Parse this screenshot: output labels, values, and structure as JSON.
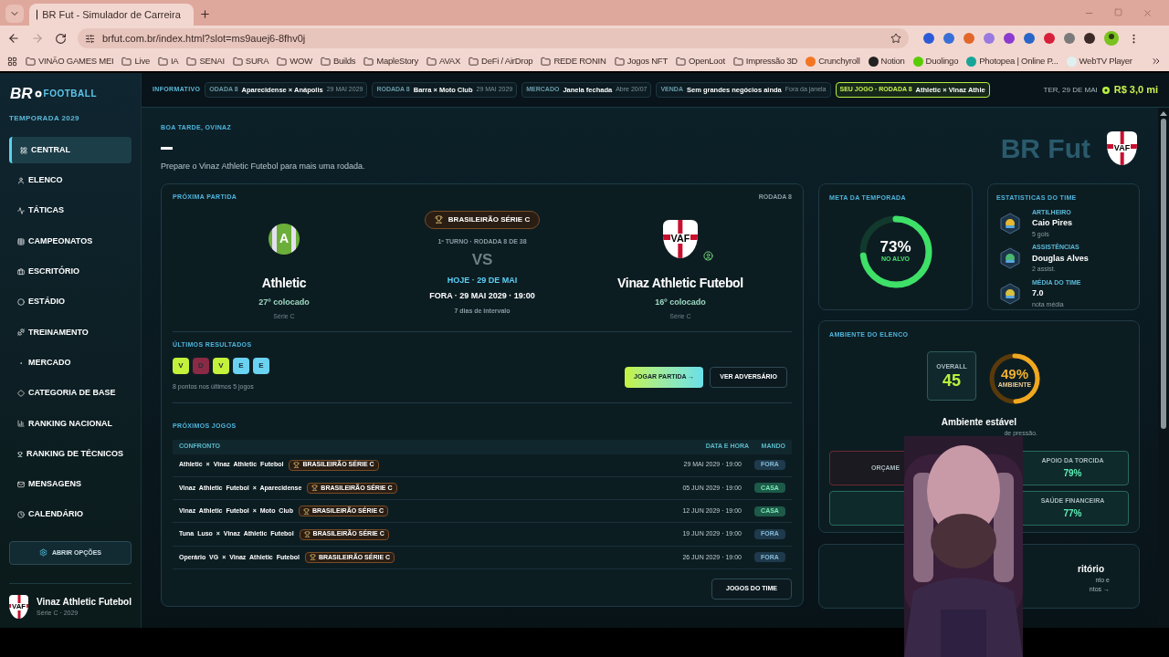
{
  "browser": {
    "tab_title": "BR Fut - Simulador de Carreira",
    "url": "brfut.com.br/index.html?slot=ms9auej6-8fhv0j",
    "bookmarks": [
      {
        "label": "VINÃO GAMES MEI",
        "kind": "folder"
      },
      {
        "label": "Live",
        "kind": "folder"
      },
      {
        "label": "IA",
        "kind": "folder"
      },
      {
        "label": "SENAI",
        "kind": "folder"
      },
      {
        "label": "SURA",
        "kind": "folder"
      },
      {
        "label": "WOW",
        "kind": "folder"
      },
      {
        "label": "Builds",
        "kind": "folder"
      },
      {
        "label": "MapleStory",
        "kind": "folder"
      },
      {
        "label": "AVAX",
        "kind": "folder"
      },
      {
        "label": "DeFi / AirDrop",
        "kind": "folder"
      },
      {
        "label": "REDE RONIN",
        "kind": "folder"
      },
      {
        "label": "Jogos NFT",
        "kind": "folder"
      },
      {
        "label": "OpenLoot",
        "kind": "folder"
      },
      {
        "label": "Impressão 3D",
        "kind": "folder"
      },
      {
        "label": "Crunchyroll",
        "kind": "site",
        "color": "#f47521"
      },
      {
        "label": "Notion",
        "kind": "site",
        "color": "#222222"
      },
      {
        "label": "Duolingo",
        "kind": "site",
        "color": "#58cc02"
      },
      {
        "label": "Photopea | Online P...",
        "kind": "site",
        "color": "#18a497"
      },
      {
        "label": "WebTV Player",
        "kind": "site",
        "color": "#e0f0f0"
      }
    ]
  },
  "sidebar": {
    "logo": {
      "mark": "BR",
      "word": "FOOTBALL"
    },
    "season": "TEMPORADA 2029",
    "items": [
      {
        "label": "CENTRAL",
        "selected": true
      },
      {
        "label": "ELENCO",
        "selected": false
      },
      {
        "label": "TÁTICAS",
        "selected": false
      },
      {
        "label": "CAMPEONATOS",
        "selected": false
      },
      {
        "label": "ESCRITÓRIO",
        "selected": false
      },
      {
        "label": "ESTÁDIO",
        "selected": false
      },
      {
        "label": "TREINAMENTO",
        "selected": false
      },
      {
        "label": "MERCADO",
        "selected": false
      },
      {
        "label": "CATEGORIA DE BASE",
        "selected": false
      },
      {
        "label": "RANKING NACIONAL",
        "selected": false
      },
      {
        "label": "RANKING DE TÉCNICOS",
        "selected": false
      },
      {
        "label": "MENSAGENS",
        "selected": false
      },
      {
        "label": "CALENDÁRIO",
        "selected": false
      }
    ],
    "options_button": "ABRIR OPÇÕES",
    "club": {
      "crest": "VAF",
      "name": "Vinaz Athletic Futebol",
      "sub": "Série C · 2029"
    }
  },
  "ticker": {
    "label": "INFORMATIVO",
    "items": [
      {
        "tag": "ODADA 8",
        "text": "Aparecidense × Anápolis",
        "note": "29 MAI 2029",
        "highlight": false
      },
      {
        "tag": "RODADA 8",
        "text": "Barra × Moto Club",
        "note": "29 MAI 2029",
        "highlight": false
      },
      {
        "tag": "MERCADO",
        "text": "Janela fechada",
        "note": "Abre 20/07",
        "highlight": false
      },
      {
        "tag": "VENDA",
        "text": "Sem grandes negócios ainda",
        "note": "Fora da janela",
        "highlight": false
      },
      {
        "tag": "SEU JOGO · RODADA 8",
        "text": "Athletic × Vinaz Athle",
        "highlight": true
      }
    ],
    "date": "TER, 29 DE MAI",
    "money": "R$ 3,0 mi"
  },
  "header": {
    "greeting": "BOA TARDE, OVINAZ",
    "subtitle": "Prepare o Vinaz Athletic Futebol para mais uma rodada.",
    "watermark": "BR Fut",
    "crest": "VAF"
  },
  "next_match": {
    "title": "PRÓXIMA PARTIDA",
    "round": "RODADA 8",
    "home": {
      "crest": "A",
      "name": "Athletic",
      "place": "27º colocado",
      "division": "Série C"
    },
    "away": {
      "crest": "VAF",
      "name": "Vinaz Athletic Futebol",
      "place": "16º colocado",
      "division": "Série C"
    },
    "competition": "BRASILEIRÃO SÉRIE C",
    "stage": "1º TURNO · RODADA 8 DE 38",
    "vs": "VS",
    "when": "HOJE · 29 DE MAI",
    "detail": "FORA · 29 MAI 2029 · 19:00",
    "rest": "7 dias de intervalo",
    "results_title": "ÚLTIMOS RESULTADOS",
    "results": [
      {
        "letter": "V",
        "color": "#c4f23a"
      },
      {
        "letter": "D",
        "color": "#8a2a45"
      },
      {
        "letter": "V",
        "color": "#c4f23a"
      },
      {
        "letter": "E",
        "color": "#6ad3f2"
      },
      {
        "letter": "E",
        "color": "#6ad3f2"
      }
    ],
    "results_note": "8 pontos nos últimos 5 jogos",
    "play_button": "JOGAR PARTIDA →",
    "opponent_button": "VER ADVERSÁRIO",
    "upcoming_title": "PRÓXIMOS JOGOS",
    "columns": [
      "CONFRONTO",
      "DATA E HORA",
      "MANDO"
    ],
    "rows": [
      {
        "matchup": "Athletic × Vinaz Athletic Futebol",
        "competition": "BRASILEIRÃO SÉRIE C",
        "datetime": "29 MAI 2029 · 19:00",
        "venue": "FORA",
        "kind": "away"
      },
      {
        "matchup": "Vinaz Athletic Futebol × Aparecidense",
        "competition": "BRASILEIRÃO SÉRIE C",
        "datetime": "05 JUN 2029 · 19:00",
        "venue": "CASA",
        "kind": "home"
      },
      {
        "matchup": "Vinaz Athletic Futebol × Moto Club",
        "competition": "BRASILEIRÃO SÉRIE C",
        "datetime": "12 JUN 2029 · 19:00",
        "venue": "CASA",
        "kind": "home"
      },
      {
        "matchup": "Tuna Luso × Vinaz Athletic Futebol",
        "competition": "BRASILEIRÃO SÉRIE C",
        "datetime": "19 JUN 2029 · 19:00",
        "venue": "FORA",
        "kind": "away"
      },
      {
        "matchup": "Operário VG × Vinaz Athletic Futebol",
        "competition": "BRASILEIRÃO SÉRIE C",
        "datetime": "26 JUN 2029 · 19:00",
        "venue": "FORA",
        "kind": "away"
      }
    ],
    "team_games_button": "JOGOS DO TIME"
  },
  "season_goal": {
    "title": "META DA TEMPORADA",
    "value": "73%",
    "caption": "NO ALVO",
    "level": 0.73
  },
  "team_stats": {
    "title": "ESTATISTICAS DO TIME",
    "items": [
      {
        "label": "ARTILHEIRO",
        "value": "Caio Pires",
        "sub": "5 gols"
      },
      {
        "label": "ASSISTÊNCIAS",
        "value": "Douglas Alves",
        "sub": "2 assist."
      },
      {
        "label": "MÉDIA DO TIME",
        "value": "7.0",
        "sub": "nota média"
      }
    ]
  },
  "squad_mood": {
    "title": "AMBIENTE DO ELENCO",
    "overall_label": "OVERALL",
    "overall": "45",
    "mood_value": "49%",
    "mood_label": "AMBIENTE",
    "level": 0.49,
    "status": "Ambiente estável",
    "note": "de pressão.",
    "tiles": [
      {
        "label": "ORÇAME",
        "kind": "alert"
      },
      {
        "label": "APOIO DA TORCIDA",
        "value": "79%",
        "kind": "good"
      },
      {
        "kind": "good"
      },
      {
        "label": "SAÚDE FINANCEIRA",
        "value": "77%",
        "kind": "good"
      }
    ]
  },
  "office_card": {
    "title": "ritório",
    "lines": [
      "nto e",
      "ntos →"
    ]
  }
}
